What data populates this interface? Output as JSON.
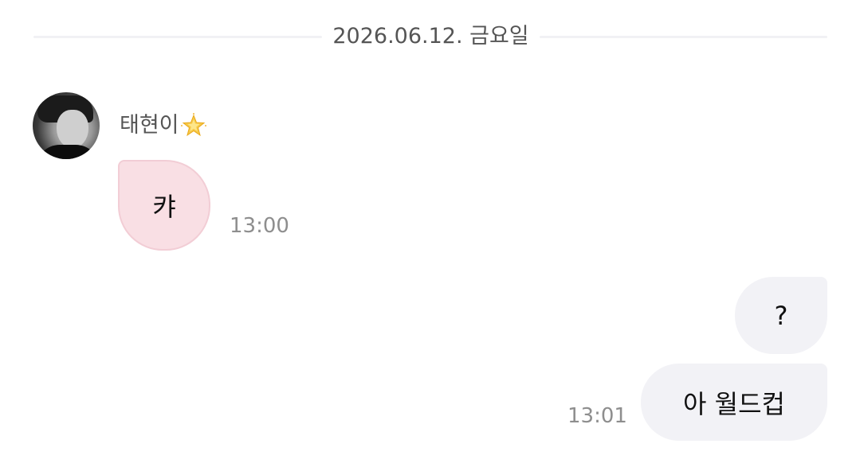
{
  "date_divider": {
    "label": "2026.06.12. 금요일"
  },
  "thread": {
    "incoming": {
      "sender_name": "태현이",
      "sender_emoji_icon": "glowing-star-icon",
      "messages": [
        {
          "text": "캬",
          "time": "13:00"
        }
      ]
    },
    "outgoing": {
      "messages": [
        {
          "text": "?"
        },
        {
          "text": "아 월드컵",
          "time": "13:01"
        }
      ]
    }
  },
  "colors": {
    "incoming_bubble": "#f9dfe4",
    "outgoing_bubble": "#f2f2f6",
    "time_text": "#8e8e8e",
    "divider_line": "#f1f1f4"
  }
}
